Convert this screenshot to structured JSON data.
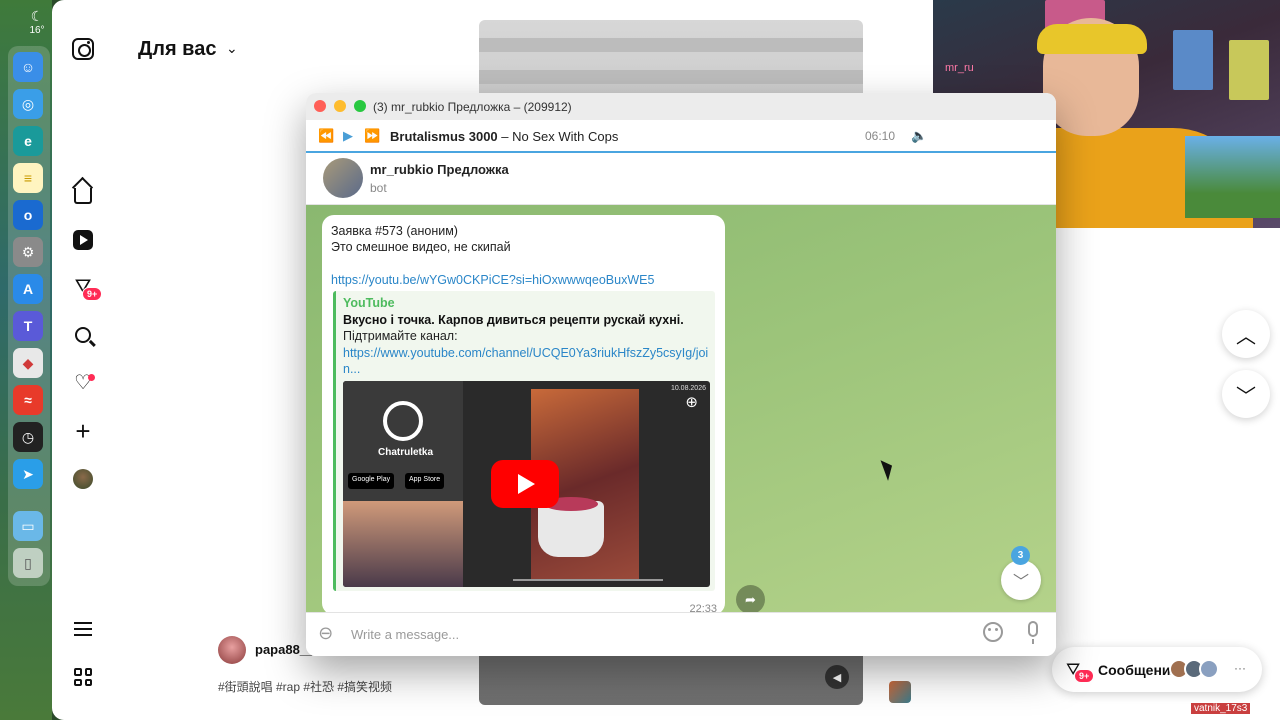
{
  "dock": {
    "weather_temp": "16°",
    "apps": [
      "finder",
      "safari",
      "edge",
      "notes",
      "outlook",
      "system-settings",
      "app-store",
      "teams",
      "launchpad",
      "anydesk",
      "activity-monitor",
      "telegram",
      "folder",
      "trash"
    ]
  },
  "instagram": {
    "feed_title": "Для вас",
    "notifications_badge": "9+",
    "post": {
      "author": "papa88__",
      "tags": "#街頭說唱 #rap #社恐 #搞笑视频"
    },
    "messages": {
      "label": "Сообщения",
      "badge": "9+",
      "more": "···"
    },
    "username_overlay": "vatnik_17s3"
  },
  "telegram": {
    "window_title": "(3) mr_rubkio Предложка – (209912)",
    "player": {
      "artist": "Brutalismus 3000",
      "separator": " – ",
      "track": "No Sex With Cops",
      "time": "06:10"
    },
    "chat": {
      "name": "mr_rubkio Предложка",
      "status": "bot"
    },
    "message": {
      "line1": "Заявка #573 (аноним)",
      "line2": "Это смешное видео, не скипай",
      "link": "https://youtu.be/wYGw0CKPiCE?si=hiOxwwwqeoBuxWE5",
      "time": "22:33",
      "preview": {
        "site": "YouTube",
        "title": "Вкусно і точка. Карпов дивиться рецепти рускай кухні.",
        "description": "Підтримайте канал:",
        "link": "https://www.youtube.com/channel/UCQE0Ya3riukHfszZy5csyIg/join...",
        "thumb_brand": "Chatruletka",
        "thumb_google": "Google Play",
        "thumb_apple": "App Store",
        "thumb_date": "10.08.2026"
      }
    },
    "unread_count": "3",
    "input_placeholder": "Write a message..."
  },
  "webcam": {
    "neon_sign": "mr_ru"
  }
}
